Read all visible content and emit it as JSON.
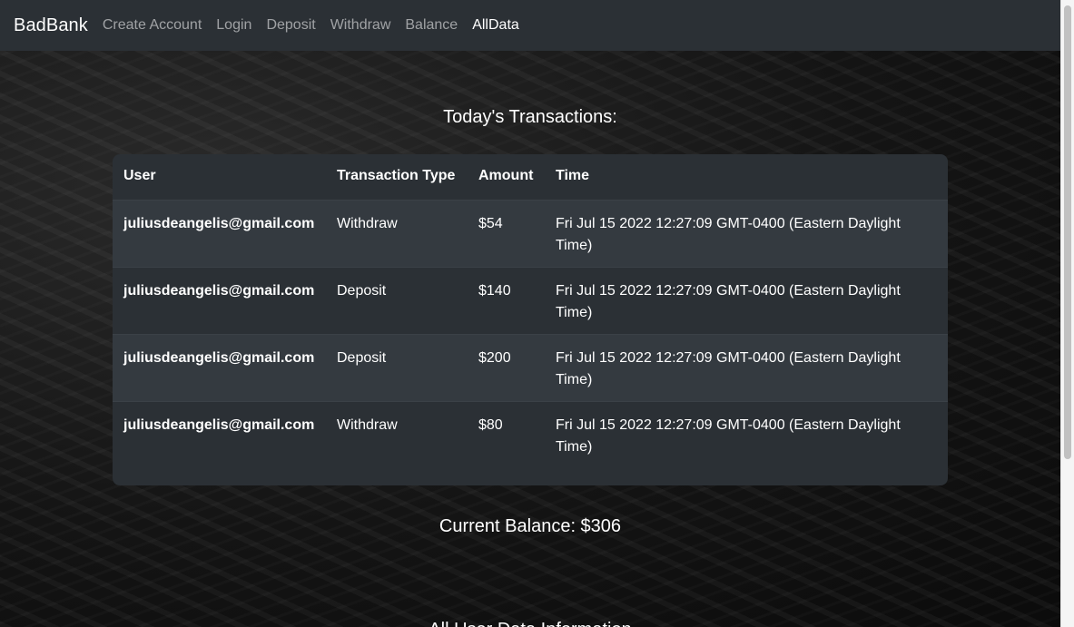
{
  "nav": {
    "brand": "BadBank",
    "links": [
      "Create Account",
      "Login",
      "Deposit",
      "Withdraw",
      "Balance",
      "AllData"
    ],
    "active": "AllData"
  },
  "transactions": {
    "heading": "Today's Transactions:",
    "columns": [
      "User",
      "Transaction Type",
      "Amount",
      "Time"
    ],
    "rows": [
      {
        "user": "juliusdeangelis@gmail.com",
        "type": "Withdraw",
        "amount": "$54",
        "time": "Fri Jul 15 2022 12:27:09 GMT-0400 (Eastern Daylight Time)"
      },
      {
        "user": "juliusdeangelis@gmail.com",
        "type": "Deposit",
        "amount": "$140",
        "time": "Fri Jul 15 2022 12:27:09 GMT-0400 (Eastern Daylight Time)"
      },
      {
        "user": "juliusdeangelis@gmail.com",
        "type": "Deposit",
        "amount": "$200",
        "time": "Fri Jul 15 2022 12:27:09 GMT-0400 (Eastern Daylight Time)"
      },
      {
        "user": "juliusdeangelis@gmail.com",
        "type": "Withdraw",
        "amount": "$80",
        "time": "Fri Jul 15 2022 12:27:09 GMT-0400 (Eastern Daylight Time)"
      }
    ]
  },
  "balance": "Current Balance: $306",
  "next_heading": "All User Data Information"
}
